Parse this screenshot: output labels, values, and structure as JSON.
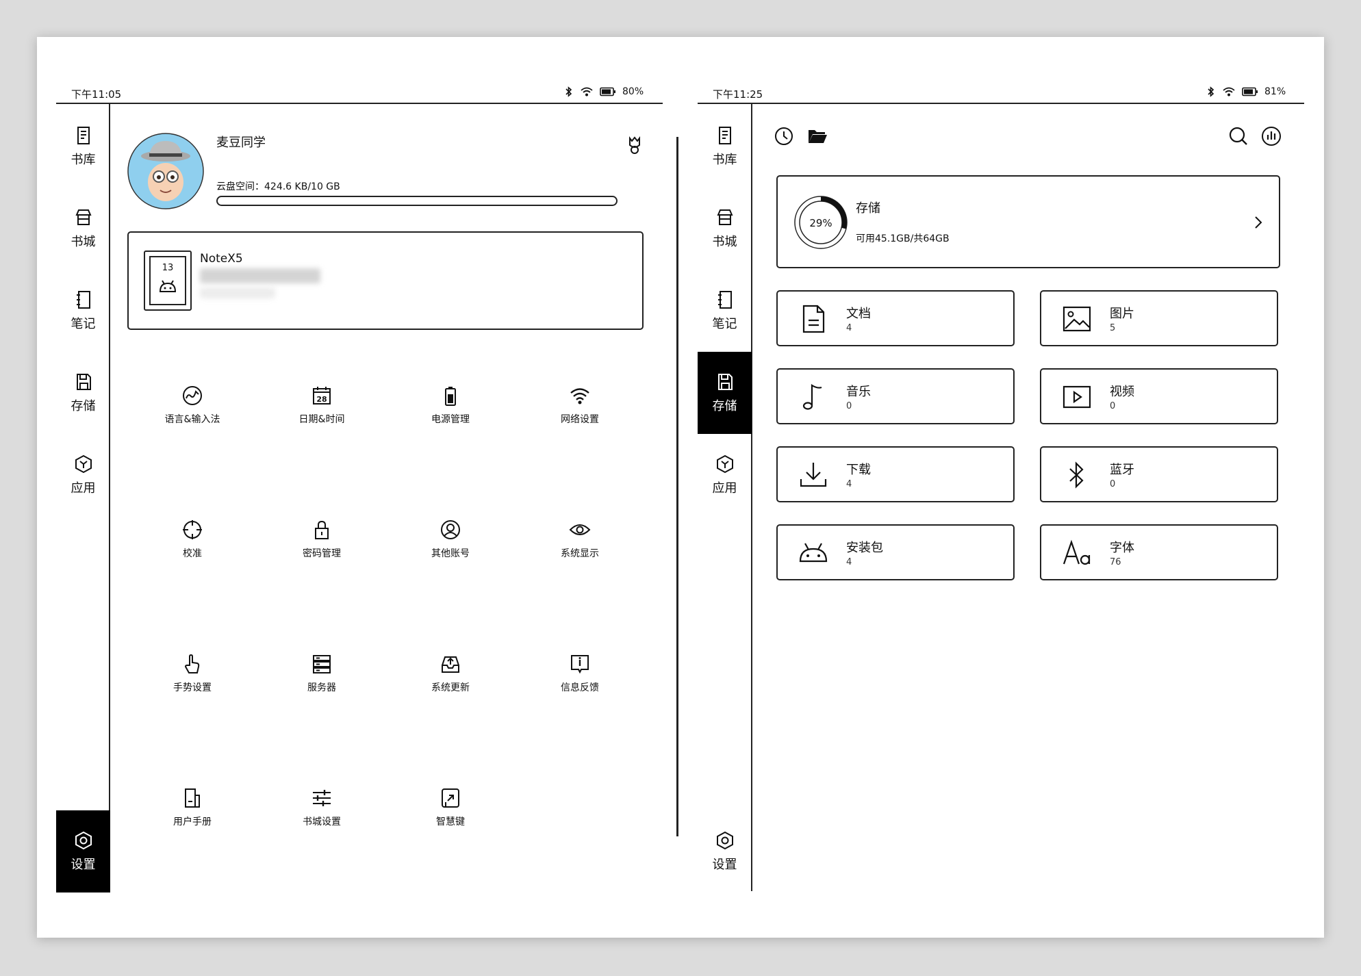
{
  "left": {
    "status": {
      "time": "下午11:05",
      "battery": "80%"
    },
    "sidebar": [
      {
        "label": "书库",
        "icon": "library-icon"
      },
      {
        "label": "书城",
        "icon": "store-icon"
      },
      {
        "label": "笔记",
        "icon": "notebook-icon"
      },
      {
        "label": "存储",
        "icon": "storage-icon"
      },
      {
        "label": "应用",
        "icon": "apps-icon"
      },
      {
        "label": "设置",
        "icon": "settings-icon"
      }
    ],
    "profile": {
      "name": "麦豆同学",
      "cloud_label": "云盘空间：",
      "cloud_value": "424.6 KB/10 GB",
      "cloud_progress": 0.0
    },
    "device": {
      "name": "NoteX5",
      "calendar_day": "13"
    },
    "settings_grid": [
      {
        "label": "语言&输入法",
        "icon": "language-icon"
      },
      {
        "label": "日期&时间",
        "icon": "calendar-icon",
        "badge": "28"
      },
      {
        "label": "电源管理",
        "icon": "battery-icon"
      },
      {
        "label": "网络设置",
        "icon": "wifi-icon"
      },
      {
        "label": "校准",
        "icon": "crosshair-icon"
      },
      {
        "label": "密码管理",
        "icon": "lock-icon"
      },
      {
        "label": "其他账号",
        "icon": "account-icon"
      },
      {
        "label": "系统显示",
        "icon": "eye-icon"
      },
      {
        "label": "手势设置",
        "icon": "gesture-icon"
      },
      {
        "label": "服务器",
        "icon": "server-icon"
      },
      {
        "label": "系统更新",
        "icon": "update-icon"
      },
      {
        "label": "信息反馈",
        "icon": "feedback-icon"
      },
      {
        "label": "用户手册",
        "icon": "manual-icon"
      },
      {
        "label": "书城设置",
        "icon": "sliders-icon"
      },
      {
        "label": "智慧键",
        "icon": "smart-key-icon"
      }
    ]
  },
  "right": {
    "status": {
      "time": "下午11:25",
      "battery": "81%"
    },
    "sidebar": [
      {
        "label": "书库",
        "icon": "library-icon"
      },
      {
        "label": "书城",
        "icon": "store-icon"
      },
      {
        "label": "笔记",
        "icon": "notebook-icon"
      },
      {
        "label": "存储",
        "icon": "storage-icon"
      },
      {
        "label": "应用",
        "icon": "apps-icon"
      },
      {
        "label": "设置",
        "icon": "settings-icon"
      }
    ],
    "storage": {
      "title": "存储",
      "percent_label": "29%",
      "used_fraction": 0.29,
      "detail": "可用45.1GB/共64GB"
    },
    "categories": [
      {
        "title": "文档",
        "count": "4",
        "icon": "document-icon"
      },
      {
        "title": "图片",
        "count": "5",
        "icon": "image-icon"
      },
      {
        "title": "音乐",
        "count": "0",
        "icon": "music-icon"
      },
      {
        "title": "视频",
        "count": "0",
        "icon": "video-icon"
      },
      {
        "title": "下载",
        "count": "4",
        "icon": "download-icon"
      },
      {
        "title": "蓝牙",
        "count": "0",
        "icon": "bluetooth-icon"
      },
      {
        "title": "安装包",
        "count": "4",
        "icon": "android-icon"
      },
      {
        "title": "字体",
        "count": "76",
        "icon": "font-icon"
      }
    ]
  }
}
